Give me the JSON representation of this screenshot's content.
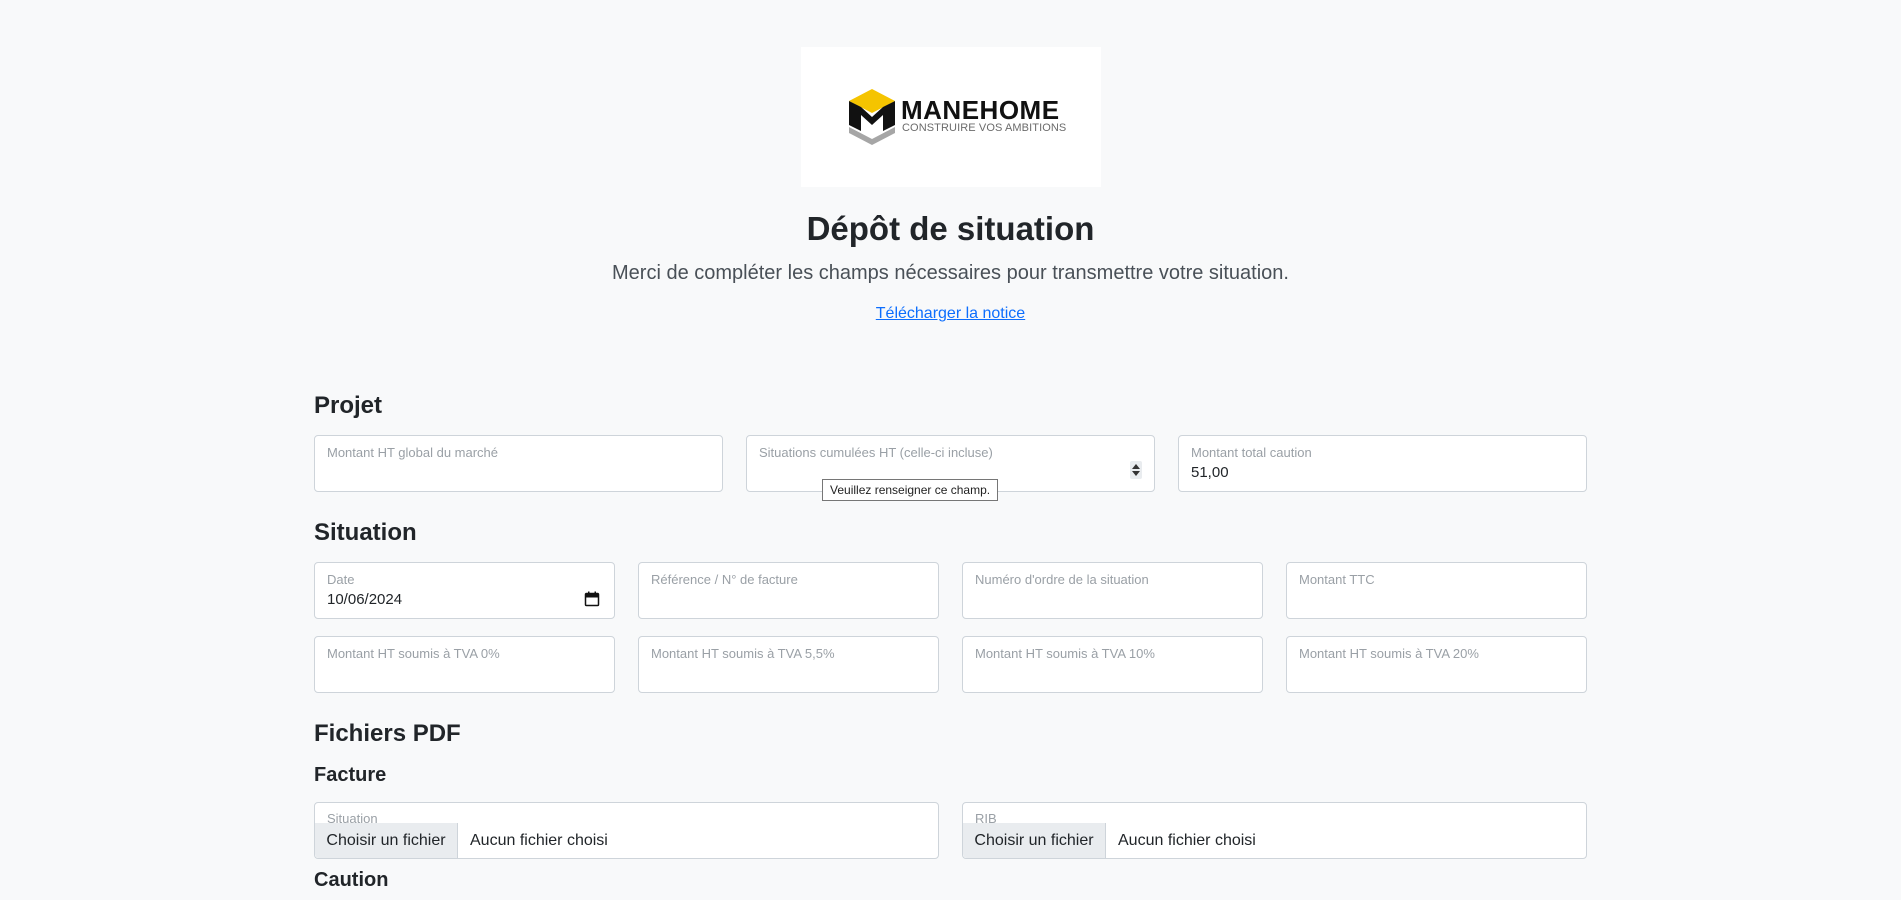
{
  "brand": {
    "name": "MANEHOME",
    "tagline": "CONSTRUIRE VOS AMBITIONS"
  },
  "header": {
    "title": "Dépôt de situation",
    "subtitle": "Merci de compléter les champs nécessaires pour transmettre votre situation.",
    "notice_link": "Télécharger la notice"
  },
  "projet": {
    "heading": "Projet",
    "montant_ht_global": {
      "label": "Montant HT global du marché",
      "value": ""
    },
    "situations_cumulees": {
      "label": "Situations cumulées HT (celle-ci incluse)",
      "value": ""
    },
    "montant_caution": {
      "label": "Montant total caution",
      "value": "51,00"
    },
    "tooltip": "Veuillez renseigner ce champ."
  },
  "situation": {
    "heading": "Situation",
    "date": {
      "label": "Date",
      "value": "10/06/2024"
    },
    "reference": {
      "label": "Référence / N° de facture",
      "value": ""
    },
    "numero_ordre": {
      "label": "Numéro d'ordre de la situation",
      "value": ""
    },
    "montant_ttc": {
      "label": "Montant TTC",
      "value": ""
    },
    "tva_0": {
      "label": "Montant HT soumis à TVA 0%",
      "value": ""
    },
    "tva_5_5": {
      "label": "Montant HT soumis à TVA 5,5%",
      "value": ""
    },
    "tva_10": {
      "label": "Montant HT soumis à TVA 10%",
      "value": ""
    },
    "tva_20": {
      "label": "Montant HT soumis à TVA 20%",
      "value": ""
    }
  },
  "fichiers": {
    "heading": "Fichiers PDF",
    "facture_heading": "Facture",
    "situation_file": {
      "label": "Situation",
      "button": "Choisir un fichier",
      "status": "Aucun fichier choisi"
    },
    "rib_file": {
      "label": "RIB",
      "button": "Choisir un fichier",
      "status": "Aucun fichier choisi"
    },
    "caution_heading": "Caution"
  },
  "colors": {
    "accent": "#0d6efd",
    "logo_yellow": "#f5c400",
    "logo_gray": "#a6a6a6",
    "logo_black": "#111111"
  },
  "icons": {
    "date_picker": "calendar-icon",
    "number_spinner": "spinner-arrows-icon"
  }
}
